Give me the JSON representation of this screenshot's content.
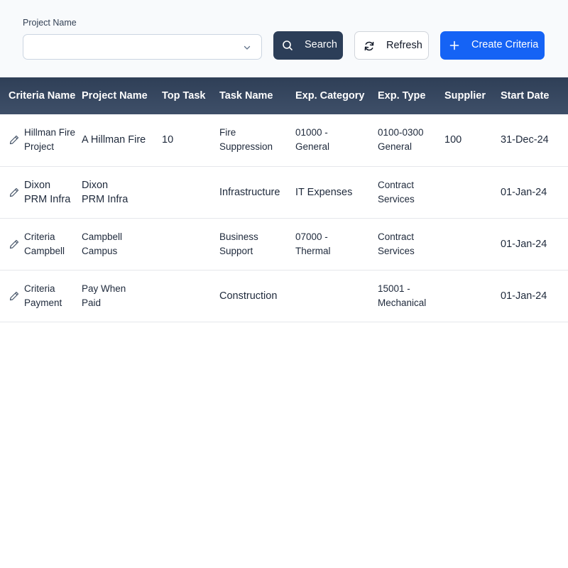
{
  "filter": {
    "label": "Project Name",
    "selected": "",
    "buttons": {
      "search": "Search",
      "refresh": "Refresh",
      "create": "Create Criteria"
    }
  },
  "table": {
    "headers": [
      "Criteria Name",
      "Project Name",
      "Top Task",
      "Task Name",
      "Exp. Category",
      "Exp. Type",
      "Supplier",
      "Start Date"
    ],
    "rows": [
      {
        "criteria_l1": "Hillman Fire",
        "criteria_l2": "Project",
        "project_l1": "A Hillman Fire",
        "project_l2": "",
        "top_task": "10",
        "task_l1": "Fire",
        "task_l2": "Suppression",
        "cat_l1": "01000 -",
        "cat_l2": "General",
        "type_l1": "0100-0300",
        "type_l2": "General",
        "supplier": "100",
        "start": "31-Dec-24"
      },
      {
        "criteria_l1": "Dixon",
        "criteria_l2": "PRM Infra",
        "project_l1": "Dixon",
        "project_l2": "PRM Infra",
        "top_task": "",
        "task_l1": "Infrastructure",
        "task_l2": "",
        "cat_l1": "IT Expenses",
        "cat_l2": "",
        "type_l1": "Contract",
        "type_l2": "Services",
        "supplier": "",
        "start": "01-Jan-24"
      },
      {
        "criteria_l1": "Criteria",
        "criteria_l2": "Campbell",
        "project_l1": "Campbell",
        "project_l2": "Campus",
        "top_task": "",
        "task_l1": "Business",
        "task_l2": "Support",
        "cat_l1": "07000 -",
        "cat_l2": "Thermal",
        "type_l1": "Contract",
        "type_l2": "Services",
        "supplier": "",
        "start": "01-Jan-24"
      },
      {
        "criteria_l1": "Criteria",
        "criteria_l2": "Payment",
        "project_l1": "Pay When",
        "project_l2": "Paid",
        "top_task": "",
        "task_l1": "Construction",
        "task_l2": "",
        "cat_l1": "",
        "cat_l2": "",
        "type_l1": "15001 -",
        "type_l2": "Mechanical",
        "supplier": "",
        "start": "01-Jan-24"
      }
    ]
  },
  "icons": {
    "search": "search-icon",
    "refresh": "refresh-icon",
    "create": "plus-icon",
    "edit": "pencil-icon",
    "dropdown": "chevron-down-icon"
  },
  "colors": {
    "header_bg": "#2f3f57",
    "search_button": "#2c3e58",
    "create_button": "#1563f5"
  }
}
